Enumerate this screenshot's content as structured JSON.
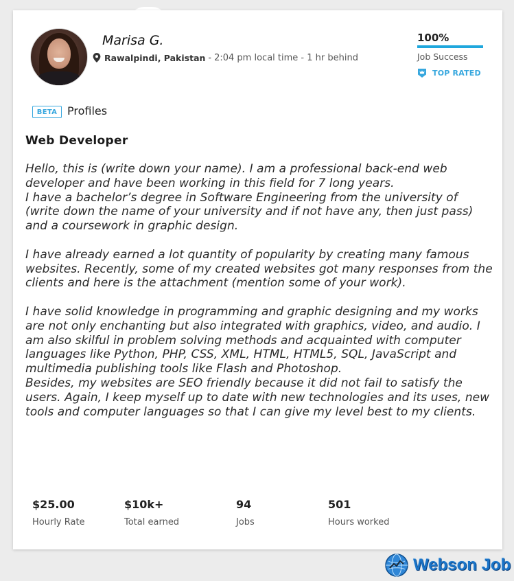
{
  "profile": {
    "name": "Marisa G.",
    "city": "Rawalpindi, Pakistan",
    "separator": "-",
    "local_time": "2:04 pm local time - 1 hr behind"
  },
  "job_success": {
    "percent_label": "100%",
    "fill_fraction": 1.0,
    "label": "Job Success",
    "top_rated": "TOP RATED"
  },
  "profiles_section": {
    "badge": "BETA",
    "title": "Profiles"
  },
  "job": {
    "title": "Web Developer",
    "description": "Hello, this is (write down your name). I am a professional back-end web developer and have been working in this field for 7 long years.\nI have a bachelor’s degree in Software Engineering from the university of (write down the name of your university and if not have any, then just pass) and a coursework in graphic design.\n\nI have already earned a lot quantity of popularity by creating many famous websites. Recently, some of my created websites got many responses from the clients and here is the attachment (mention some of your work).\n\nI have solid knowledge in programming and graphic designing and my works are not only enchanting but also integrated with graphics, video, and audio. I am also skilful in problem solving methods and acquainted with computer languages like Python, PHP, CSS, XML, HTML, HTML5, SQL, JavaScript and multimedia publishing tools like Flash and Photoshop.\nBesides, my websites are SEO friendly because it did not fail to satisfy the users. Again, I keep myself up to date with new technologies and its uses, new tools and computer languages so that I can give my level best to my clients."
  },
  "stats": [
    {
      "value": "$25.00",
      "label": "Hourly Rate"
    },
    {
      "value": "$10k+",
      "label": "Total earned"
    },
    {
      "value": "94",
      "label": "Jobs"
    },
    {
      "value": "501",
      "label": "Hours worked"
    }
  ],
  "watermark": {
    "text": "Webson Job"
  },
  "colors": {
    "accent": "#37a7de",
    "progress": "#1fa7dd",
    "card_bg": "#ffffff",
    "page_bg": "#ececec"
  },
  "icons": {
    "location": "map-pin-icon",
    "top_rated": "top-rated-badge-icon",
    "watermark": "globe-icon"
  }
}
